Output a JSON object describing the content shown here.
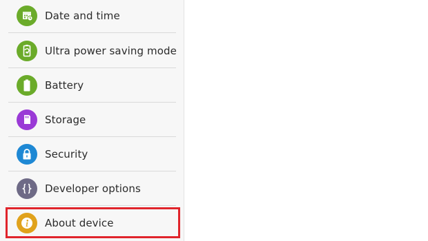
{
  "settings_menu": {
    "items": [
      {
        "label": "Date and time",
        "icon": "calendar-clock-icon",
        "color": "#6bab2a"
      },
      {
        "label": "Ultra power saving mode",
        "icon": "power-saving-recycle-icon",
        "color": "#6bab2a"
      },
      {
        "label": "Battery",
        "icon": "battery-icon",
        "color": "#6bab2a"
      },
      {
        "label": "Storage",
        "icon": "sd-card-icon",
        "color": "#9a3ad6"
      },
      {
        "label": "Security",
        "icon": "lock-icon",
        "color": "#1e88d4"
      },
      {
        "label": "Developer options",
        "icon": "curly-braces-icon",
        "color": "#6e6a86"
      },
      {
        "label": "About device",
        "icon": "info-icon",
        "color": "#e0a21c"
      }
    ],
    "selected": "About device",
    "highlight_color": "#e0242b"
  }
}
